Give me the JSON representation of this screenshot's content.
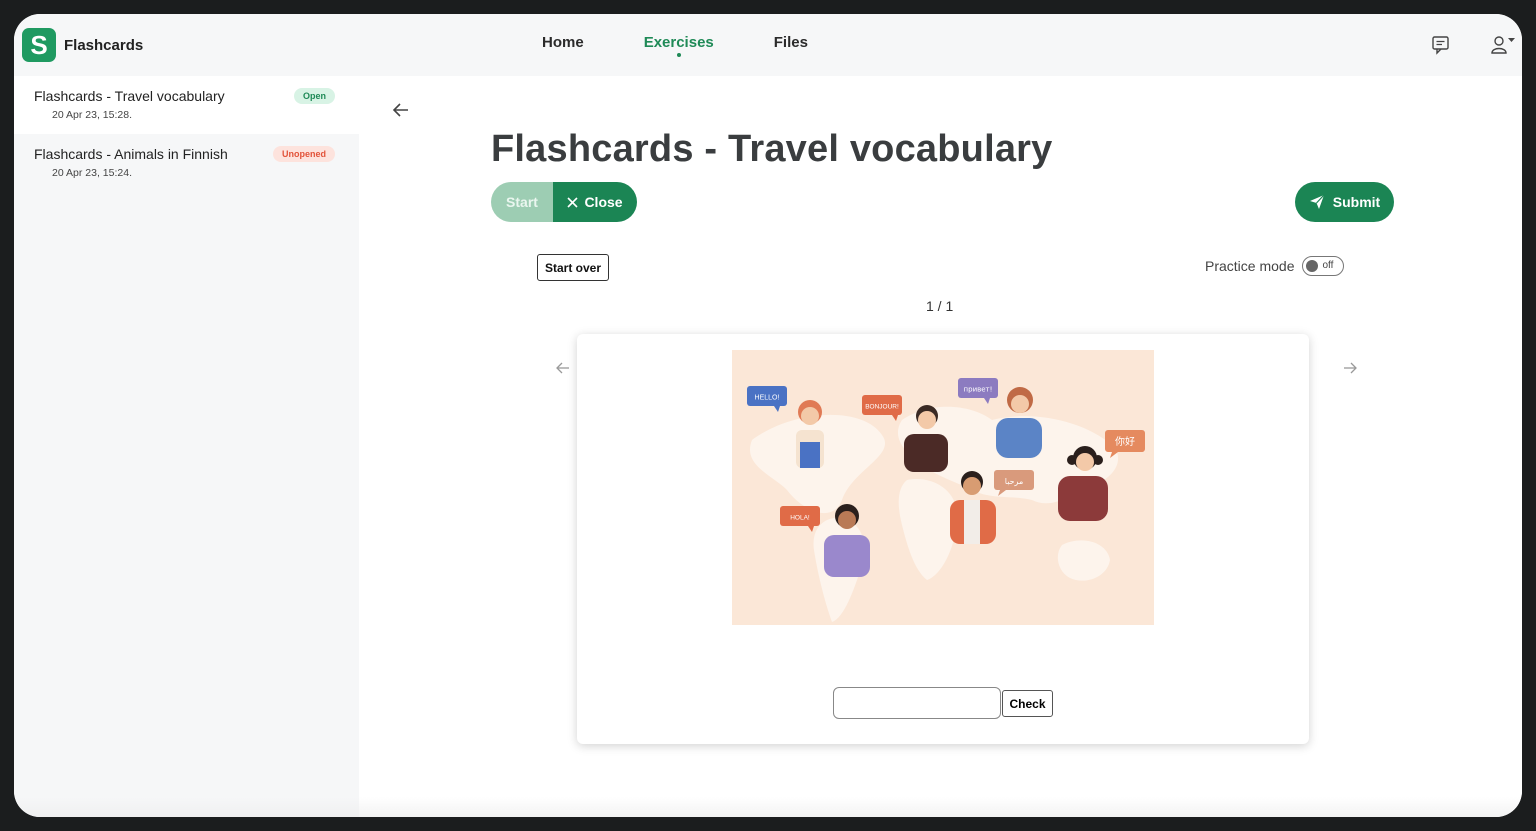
{
  "app": {
    "name": "Flashcards",
    "logo_letter": "S"
  },
  "nav": {
    "items": [
      {
        "label": "Home",
        "active": false
      },
      {
        "label": "Exercises",
        "active": true
      },
      {
        "label": "Files",
        "active": false
      }
    ]
  },
  "topbar_icons": [
    "comment-icon",
    "user-menu-icon"
  ],
  "sidebar": {
    "items": [
      {
        "title": "Flashcards - Travel vocabulary",
        "date": "20 Apr 23, 15:28.",
        "badge": "Open",
        "selected": true
      },
      {
        "title": "Flashcards - Animals in Finnish",
        "date": "20 Apr 23, 15:24.",
        "badge": "Unopened",
        "selected": false
      }
    ]
  },
  "main": {
    "title": "Flashcards - Travel vocabulary",
    "start_label": "Start",
    "close_label": "Close",
    "submit_label": "Submit",
    "start_over_label": "Start over",
    "practice_mode_label": "Practice mode",
    "practice_mode_state": "off",
    "counter": "1 / 1",
    "check_label": "Check",
    "answer_value": "",
    "bubbles": [
      "HELLO!",
      "BONJOUR!",
      "привет!",
      "你好",
      "HOLA!",
      "مرحبا"
    ]
  },
  "colors": {
    "brand": "#1f9a61",
    "primary_button": "#1b8554",
    "start_button_disabled": "#9dcdb3",
    "active_nav": "#1f8a57",
    "card_image_bg": "#fbe7d7"
  }
}
